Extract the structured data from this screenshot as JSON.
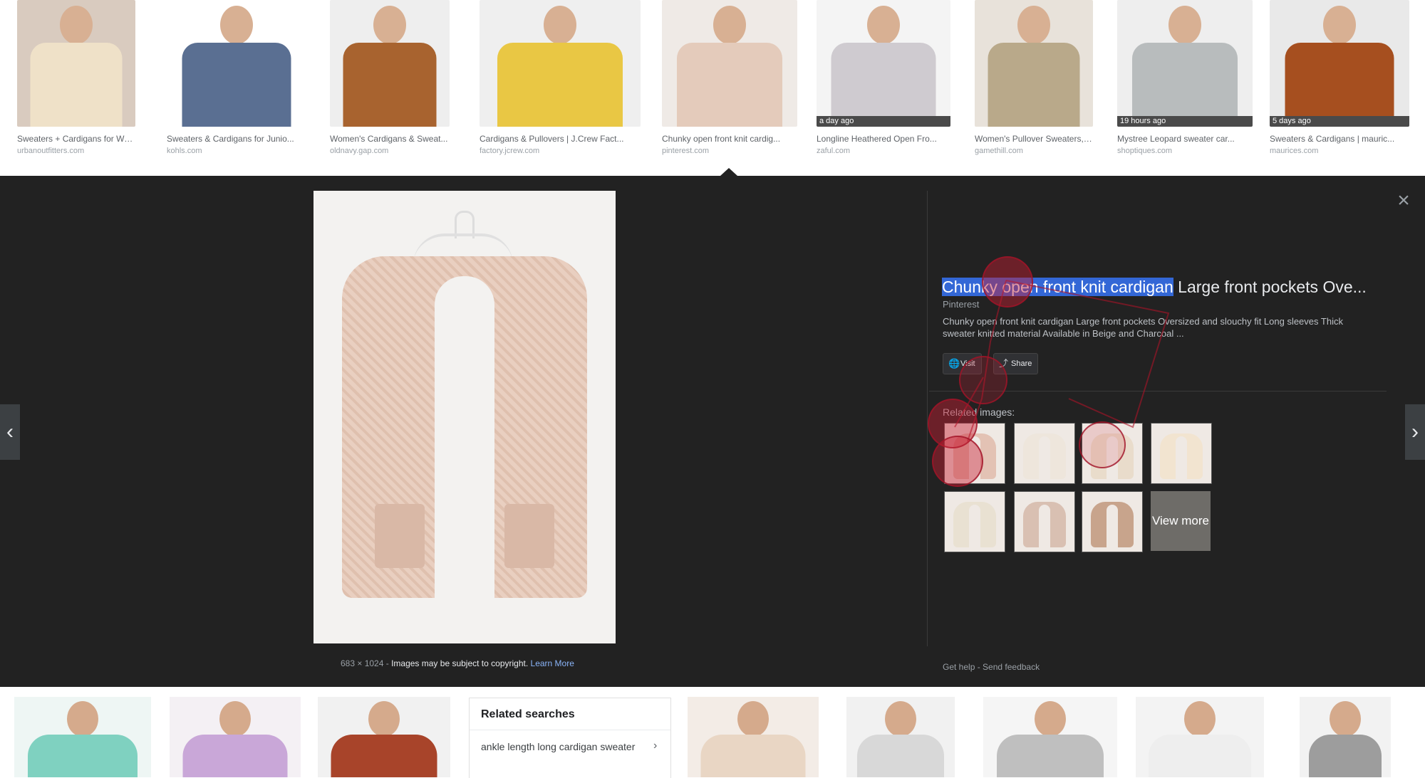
{
  "top_results": [
    {
      "title": "Sweaters + Cardigans for Wo...",
      "source": "urbanoutfitters.com",
      "badge": "",
      "bg": "#d9cbbf",
      "garment": "#efe1c8"
    },
    {
      "title": "Sweaters & Cardigans for Junio...",
      "source": "kohls.com",
      "badge": "",
      "bg": "#ffffff",
      "garment": "#5a6f92"
    },
    {
      "title": "Women's Cardigans & Sweat...",
      "source": "oldnavy.gap.com",
      "badge": "",
      "bg": "#eeeeee",
      "garment": "#a8632f"
    },
    {
      "title": "Cardigans & Pullovers | J.Crew Fact...",
      "source": "factory.jcrew.com",
      "badge": "",
      "bg": "#efefef",
      "garment": "#e9c744"
    },
    {
      "title": "Chunky open front knit cardig...",
      "source": "pinterest.com",
      "badge": "",
      "bg": "#efeae6",
      "garment": "#e4cbbb"
    },
    {
      "title": "Longline Heathered Open Fro...",
      "source": "zaful.com",
      "badge": "a day ago",
      "bg": "#f4f4f4",
      "garment": "#cfcbd0"
    },
    {
      "title": "Women's Pullover Sweaters, ...",
      "source": "gamethill.com",
      "badge": "",
      "bg": "#e8e2da",
      "garment": "#b9a98a"
    },
    {
      "title": "Mystree Leopard sweater car...",
      "source": "shoptiques.com",
      "badge": "19 hours ago",
      "bg": "#eeeeee",
      "garment": "#b8bcbd"
    },
    {
      "title": "Sweaters & Cardigans | mauric...",
      "source": "maurices.com",
      "badge": "5 days ago",
      "bg": "#e9e9e9",
      "garment": "#a64f1f"
    }
  ],
  "preview": {
    "footer_dims": "683 × 1024",
    "footer_sep": " - ",
    "footer_copyright": "Images may be subject to copyright.",
    "footer_learn": "Learn More",
    "close_glyph": "×",
    "title_selected": "Chunky open front knit cardigan",
    "title_rest": " Large front pockets Ove...",
    "source": "Pinterest",
    "description": "Chunky open front knit cardigan Large front pockets Oversized and slouchy fit Long sleeves Thick sweater knitted material Available in Beige and Charcoal ...",
    "visit_label": "Visit",
    "share_label": "Share",
    "related_label": "Related images:",
    "view_more_label": "View more",
    "help_footer": "Get help - Send feedback",
    "nav_prev": "‹",
    "nav_next": "›"
  },
  "related_thumbs": [
    {
      "color": "#e3c2b4"
    },
    {
      "color": "#eee6dc"
    },
    {
      "color": "#e9dccb"
    },
    {
      "color": "#f2e4d0"
    },
    {
      "color": "#e9e1d2"
    },
    {
      "color": "#d9c0b2"
    },
    {
      "color": "#c8a48c"
    }
  ],
  "bottom_results": [
    {
      "bg": "#eef6f4",
      "body": "#7fd1c0"
    },
    {
      "bg": "#f4f0f4",
      "body": "#c9a7d8"
    },
    {
      "bg": "#f1f1f1",
      "body": "#a8442a"
    },
    {
      "bg": "#f3ece6",
      "body": "#e9d6c4"
    },
    {
      "bg": "#f1f1f1",
      "body": "#d8d8d8"
    },
    {
      "bg": "#f5f5f5",
      "body": "#bfbfbf"
    },
    {
      "bg": "#f3f3f3",
      "body": "#eeeeee"
    },
    {
      "bg": "#f2f2f2",
      "body": "#9d9d9d"
    }
  ],
  "related_searches": {
    "heading": "Related searches",
    "item": "ankle length long cardigan sweater",
    "chevron": "›"
  }
}
